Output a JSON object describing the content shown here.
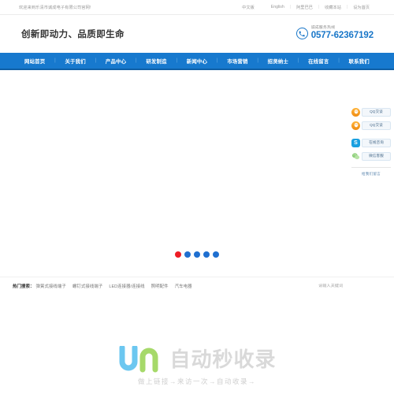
{
  "topbar": {
    "welcome": "欢迎来到乐清市诚成电子有限公司官网!",
    "lang_cn": "中文版",
    "lang_en": "English",
    "link_ali": "阿里巴巴",
    "link_fav": "收藏本站",
    "link_home": "设为首页",
    "separator": "|"
  },
  "header": {
    "slogan": "创新即动力、品质即生命",
    "hotline_label": "诚成服务热线",
    "hotline_number": "0577-62367192"
  },
  "nav": {
    "separator": "|",
    "items": [
      {
        "label": "网站首页"
      },
      {
        "label": "关于我们"
      },
      {
        "label": "产品中心"
      },
      {
        "label": "研发制造"
      },
      {
        "label": "新闻中心"
      },
      {
        "label": "市场营销"
      },
      {
        "label": "招贤纳士"
      },
      {
        "label": "在线留言"
      },
      {
        "label": "联系我们"
      }
    ]
  },
  "banner": {
    "dots": [
      {
        "active": true
      },
      {
        "active": false
      },
      {
        "active": false
      },
      {
        "active": false
      },
      {
        "active": false
      }
    ],
    "active_color": "#ee1c25",
    "inactive_color": "#1f6fd0"
  },
  "search": {
    "hot_label": "热门搜索：",
    "keywords": [
      "弹簧式接线端子",
      "螺钉式接线端子",
      "LED连接器/连接线",
      "照明配件",
      "汽车电器"
    ],
    "placeholder": "请输入关键词",
    "value": ""
  },
  "float_widget": {
    "items": [
      {
        "icon": "qq-icon",
        "label": "QQ交谈"
      },
      {
        "icon": "qq-icon",
        "label": "QQ交谈"
      },
      {
        "icon": "skype-icon",
        "label": "在线咨询"
      },
      {
        "icon": "wechat-icon",
        "label": "微信客服"
      }
    ],
    "bottom_link": "给我们留言"
  },
  "watermark": {
    "title": "自动秒收录",
    "tagline": "做上链接→来访一次→自动收录→"
  },
  "colors": {
    "nav_bg": "#1779ce",
    "nav_border": "#0f5fa5",
    "brand_blue": "#1876c8",
    "accent_red": "#ee1c25"
  }
}
